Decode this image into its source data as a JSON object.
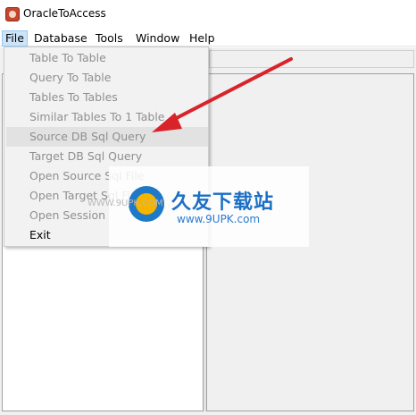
{
  "window": {
    "title": "OracleToAccess",
    "icon": "app-icon"
  },
  "menubar": {
    "items": [
      {
        "label": "File",
        "active": true
      },
      {
        "label": "Database"
      },
      {
        "label": "Tools"
      },
      {
        "label": "Window"
      },
      {
        "label": "Help"
      }
    ]
  },
  "file_menu": {
    "items": [
      {
        "label": "Table To Table",
        "enabled": false
      },
      {
        "label": "Query To Table",
        "enabled": false
      },
      {
        "label": "Tables To Tables",
        "enabled": false
      },
      {
        "label": "Similar Tables To 1 Table",
        "enabled": false
      },
      {
        "label": "Source DB Sql Query",
        "enabled": false,
        "hovered": true
      },
      {
        "label": "Target DB Sql Query",
        "enabled": false
      },
      {
        "label": "Open Source Sql File",
        "enabled": false
      },
      {
        "label": "Open Target Sql File",
        "enabled": false
      },
      {
        "label": "Open Session",
        "enabled": false
      },
      {
        "label": "Exit",
        "enabled": true
      }
    ]
  },
  "watermark": {
    "chinese": "久友下载站",
    "url": "www.9UPK.com",
    "url_small": "WWW.9UPK.COM"
  },
  "colors": {
    "accent": "#cce4f7",
    "disabled_text": "#8f8f8f",
    "arrow": "#d9232a",
    "watermark": "#1c6fc4"
  }
}
